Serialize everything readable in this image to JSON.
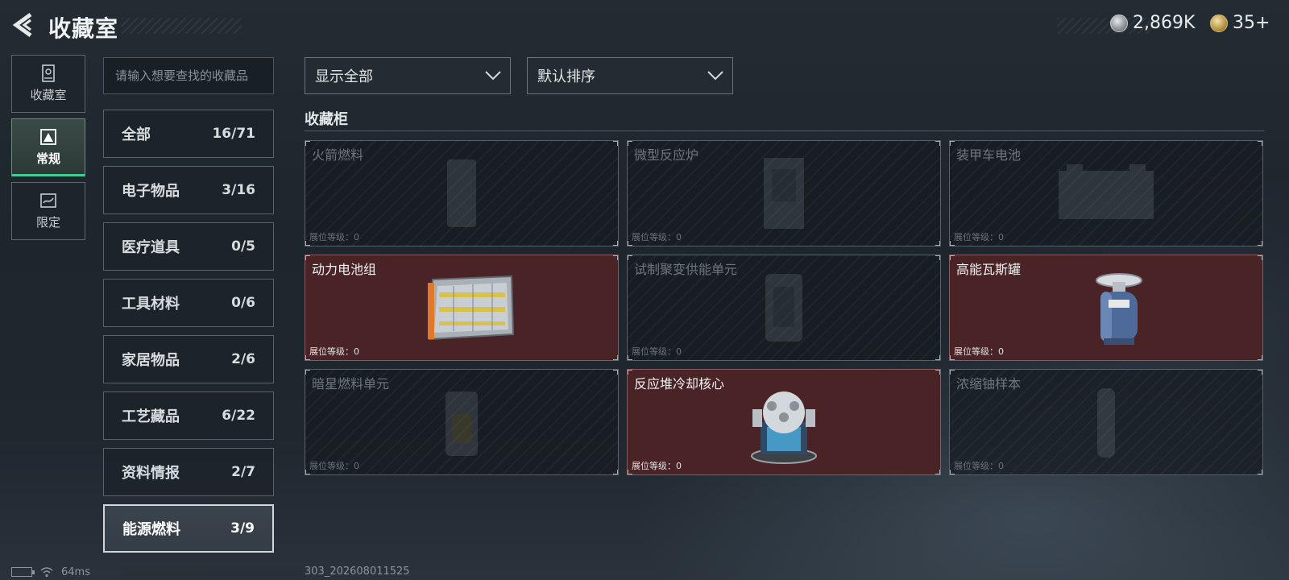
{
  "header": {
    "title": "收藏室",
    "currencies": [
      {
        "icon": "silver-coin-icon",
        "amount": "2,869K"
      },
      {
        "icon": "gold-coin-icon",
        "amount": "35+"
      }
    ]
  },
  "side_nav": [
    {
      "label": "收藏室",
      "icon": "collection-room-icon",
      "active": false
    },
    {
      "label": "常规",
      "icon": "regular-icon",
      "active": true
    },
    {
      "label": "限定",
      "icon": "limited-icon",
      "active": false
    }
  ],
  "search": {
    "placeholder": "请输入想要查找的收藏品",
    "value": ""
  },
  "categories": [
    {
      "name": "全部",
      "count": "16/71"
    },
    {
      "name": "电子物品",
      "count": "3/16"
    },
    {
      "name": "医疗道具",
      "count": "0/5"
    },
    {
      "name": "工具材料",
      "count": "0/6"
    },
    {
      "name": "家居物品",
      "count": "2/6"
    },
    {
      "name": "工艺藏品",
      "count": "6/22"
    },
    {
      "name": "资料情报",
      "count": "2/7"
    },
    {
      "name": "能源燃料",
      "count": "3/9",
      "active": true
    }
  ],
  "filters": {
    "display": "显示全部",
    "sort": "默认排序"
  },
  "cabinet": {
    "title": "收藏柜",
    "level_label": "展位等级：",
    "items": [
      {
        "name": "火箭燃料",
        "level": "0",
        "owned": false
      },
      {
        "name": "微型反应炉",
        "level": "0",
        "owned": false
      },
      {
        "name": "装甲车电池",
        "level": "0",
        "owned": false
      },
      {
        "name": "动力电池组",
        "level": "0",
        "owned": true
      },
      {
        "name": "试制聚变供能单元",
        "level": "0",
        "owned": false
      },
      {
        "name": "高能瓦斯罐",
        "level": "0",
        "owned": true
      },
      {
        "name": "暗星燃料单元",
        "level": "0",
        "owned": false
      },
      {
        "name": "反应堆冷却核心",
        "level": "0",
        "owned": true
      },
      {
        "name": "浓缩铀样本",
        "level": "0",
        "owned": false
      }
    ]
  },
  "status_bar": {
    "ping": "64ms",
    "build": "303_202608011525"
  },
  "colors": {
    "accent": "#3fcf95",
    "owned_tile": "#4a2326"
  }
}
